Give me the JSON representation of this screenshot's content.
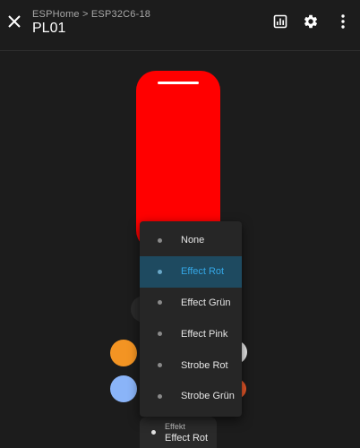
{
  "header": {
    "breadcrumb": "ESPHome > ESP32C6-18",
    "title": "PL01",
    "close_icon": "close-icon",
    "history_icon": "chart-icon",
    "settings_icon": "gear-icon",
    "more_icon": "more-vertical-icon"
  },
  "light": {
    "color": "#ff0000"
  },
  "colors": {
    "accent": "#34a7e6",
    "swatch_orange": "#f39423",
    "swatch_blue": "#8ab4f8",
    "swatch_white": "#f0f0f0",
    "swatch_red": "#f05a2a"
  },
  "effect_select": {
    "label": "Effekt",
    "value": "Effect Rot"
  },
  "menu": {
    "items": [
      {
        "label": "None"
      },
      {
        "label": "Effect Rot"
      },
      {
        "label": "Effect Grün"
      },
      {
        "label": "Effect Pink"
      },
      {
        "label": "Strobe Rot"
      },
      {
        "label": "Strobe Grün"
      }
    ],
    "selected": "Effect Rot"
  }
}
